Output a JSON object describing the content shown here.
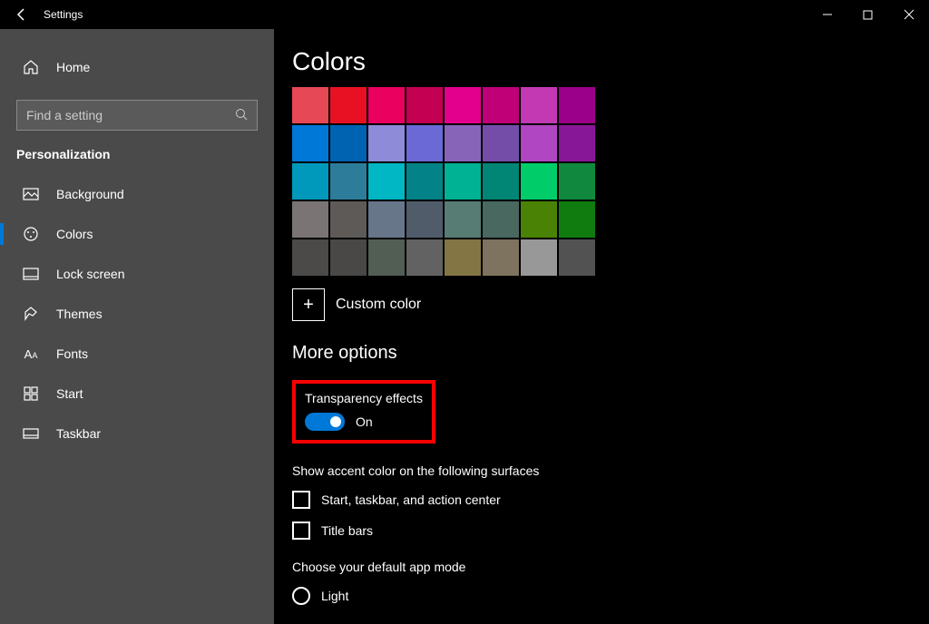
{
  "titlebar": {
    "title": "Settings"
  },
  "sidebar": {
    "home": "Home",
    "search_placeholder": "Find a setting",
    "section": "Personalization",
    "items": [
      {
        "label": "Background"
      },
      {
        "label": "Colors",
        "selected": true
      },
      {
        "label": "Lock screen"
      },
      {
        "label": "Themes"
      },
      {
        "label": "Fonts"
      },
      {
        "label": "Start"
      },
      {
        "label": "Taskbar"
      }
    ]
  },
  "content": {
    "heading": "Colors",
    "swatches": [
      [
        "#e74856",
        "#e81123",
        "#ea005e",
        "#c30052",
        "#e3008c",
        "#bf0077",
        "#c239b3",
        "#9a0089"
      ],
      [
        "#0078d7",
        "#0063b1",
        "#8e8cd8",
        "#6b69d6",
        "#8764b8",
        "#744da9",
        "#b146c2",
        "#881798"
      ],
      [
        "#0099bc",
        "#2d7d9a",
        "#00b7c3",
        "#038387",
        "#00b294",
        "#018574",
        "#00cc6a",
        "#10893e"
      ],
      [
        "#7a7574",
        "#5d5a58",
        "#68768a",
        "#515c6b",
        "#567c73",
        "#486860",
        "#498205",
        "#107c10"
      ],
      [
        "#4c4a48",
        "#4a4846",
        "#525e54",
        "#626262",
        "#847545",
        "#7e735f",
        "#989898",
        "#525252"
      ]
    ],
    "custom_color": "Custom color",
    "more_options": "More options",
    "transparency": {
      "label": "Transparency effects",
      "state": "On"
    },
    "accent_label": "Show accent color on the following surfaces",
    "accent_options": [
      "Start, taskbar, and action center",
      "Title bars"
    ],
    "mode_label": "Choose your default app mode",
    "mode_option": "Light"
  }
}
